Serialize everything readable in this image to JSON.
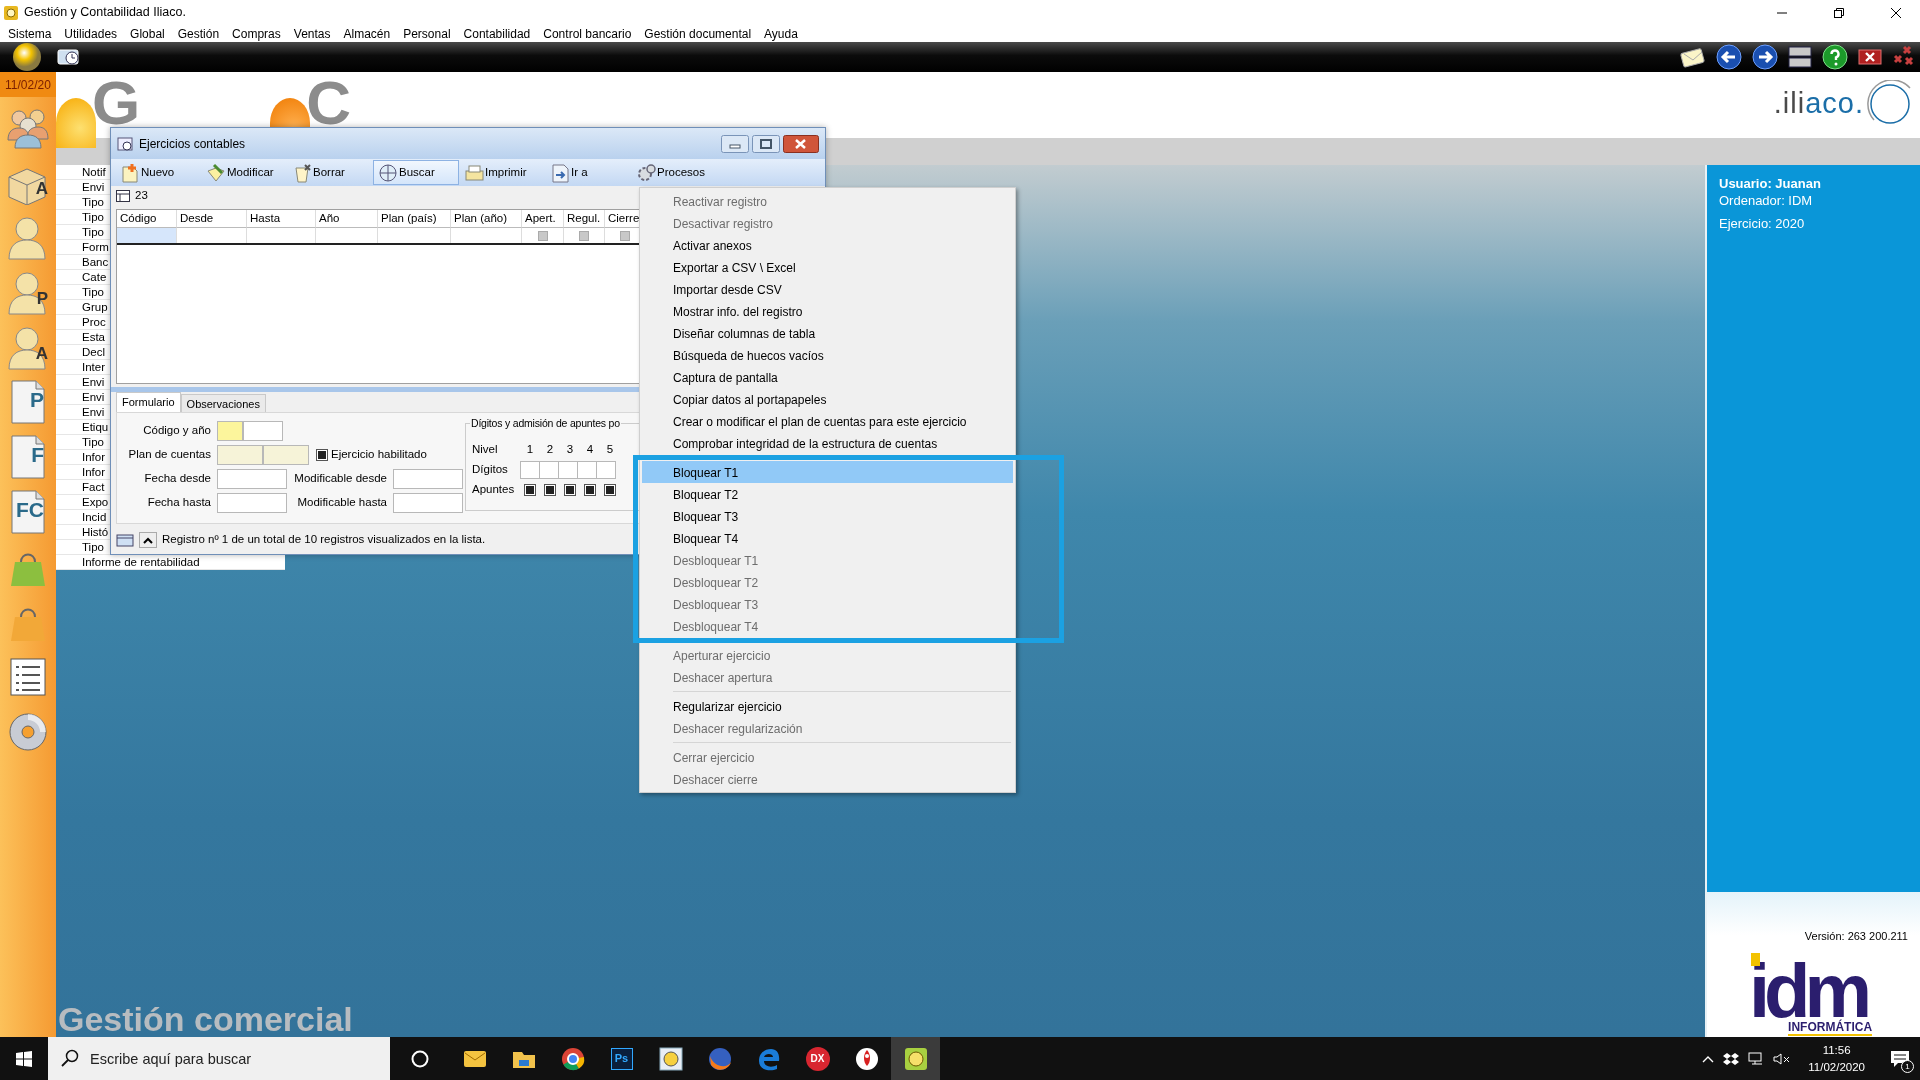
{
  "app_title": "Gestión y Contabilidad Iliaco.",
  "menu": [
    "Sistema",
    "Utilidades",
    "Global",
    "Gestión",
    "Compras",
    "Ventas",
    "Almacén",
    "Personal",
    "Contabilidad",
    "Control bancario",
    "Gestión documental",
    "Ayuda"
  ],
  "sidebar": {
    "date": "11/02/20",
    "buttons": [
      {
        "kind": "people"
      },
      {
        "kind": "box",
        "letter": "A"
      },
      {
        "kind": "person"
      },
      {
        "kind": "person",
        "letter": "P"
      },
      {
        "kind": "person",
        "letter": "A"
      },
      {
        "kind": "doc",
        "letter": "P"
      },
      {
        "kind": "doc",
        "letter": "F"
      },
      {
        "kind": "doc",
        "letter": "FC"
      },
      {
        "kind": "bag",
        "color": "#8cbf3f"
      },
      {
        "kind": "bag",
        "color": "#f2a838"
      },
      {
        "kind": "list"
      },
      {
        "kind": "disc"
      }
    ]
  },
  "logos": [
    {
      "letter": "G"
    },
    {
      "letter": "C"
    }
  ],
  "iliaco_logo": {
    "dark": ".ili",
    "blue": "aco."
  },
  "nav_list": [
    "Notif",
    "Envi",
    "Tipo",
    "Tipo",
    "Tipo",
    "Form",
    "Banc",
    "Cate",
    "Tipo",
    "Grup",
    "Proc",
    "Esta",
    "Decl",
    "Inter",
    "Envi",
    "Envi",
    "Envi",
    "Etiqu",
    "Tipo",
    "Infor",
    "Infor",
    "Fact",
    "Expo",
    "Incid",
    "Histó",
    "Tipo",
    "Informe de rentabilidad"
  ],
  "window": {
    "title": "Ejercicios contables",
    "toolbar": [
      {
        "kind": "new",
        "label": "Nuevo",
        "pressed": false
      },
      {
        "kind": "edit",
        "label": "Modificar",
        "pressed": false
      },
      {
        "kind": "delete",
        "label": "Borrar",
        "pressed": false
      },
      {
        "kind": "search",
        "label": "Buscar",
        "pressed": true
      },
      {
        "kind": "print",
        "label": "Imprimir",
        "pressed": false
      },
      {
        "kind": "goto",
        "label": "Ir a",
        "pressed": false
      },
      {
        "kind": "process",
        "label": "Procesos",
        "pressed": false
      }
    ],
    "record_count": "23",
    "table": {
      "columns": [
        {
          "label": "Código",
          "kind": "text"
        },
        {
          "label": "Desde",
          "kind": "text"
        },
        {
          "label": "Hasta",
          "kind": "text"
        },
        {
          "label": "Año",
          "kind": "text"
        },
        {
          "label": "Plan (país)",
          "kind": "text"
        },
        {
          "label": "Plan (año)",
          "kind": "text"
        },
        {
          "label": "Apert.",
          "kind": "flag"
        },
        {
          "label": "Regul.",
          "kind": "flag"
        },
        {
          "label": "Cierre",
          "kind": "flag"
        }
      ],
      "rows": [
        {
          "selected": true,
          "flags": [
            {
              "checked": false
            },
            {
              "checked": false
            },
            {
              "checked": false
            }
          ]
        }
      ]
    },
    "form_tabs": [
      {
        "label": "Formulario",
        "selected": true
      },
      {
        "label": "Observaciones",
        "selected": false
      }
    ],
    "form_rows": [
      [
        {
          "kind": "field",
          "label": "Código y año",
          "inputs": [
            {
              "kind": "required"
            },
            {
              "kind": "plain"
            }
          ]
        }
      ],
      [
        {
          "kind": "field",
          "label": "Plan de cuentas",
          "inputs": [
            {
              "kind": "readonly"
            },
            {
              "kind": "readonly"
            }
          ]
        },
        {
          "kind": "checkbox",
          "label": "Ejercicio habilitado",
          "checked": true
        }
      ],
      [
        {
          "kind": "field",
          "label": "Fecha desde",
          "inputs": [
            {
              "kind": "wide"
            }
          ]
        },
        {
          "kind": "field",
          "label": "Modificable desde",
          "inputs": [
            {
              "kind": "wide"
            }
          ]
        }
      ],
      [
        {
          "kind": "field",
          "label": "Fecha hasta",
          "inputs": [
            {
              "kind": "wide"
            }
          ]
        },
        {
          "kind": "field",
          "label": "Modificable hasta",
          "inputs": [
            {
              "kind": "wide"
            }
          ]
        }
      ]
    ],
    "digits_group": {
      "title": "Dígitos y admisión de apuntes po",
      "levels_label": "Nivel",
      "levels": [
        "1",
        "2",
        "3",
        "4",
        "5"
      ],
      "digits_label": "Dígitos",
      "entries_label": "Apuntes",
      "entries": [
        {
          "checked": true
        },
        {
          "checked": true
        },
        {
          "checked": true
        },
        {
          "checked": true
        },
        {
          "checked": true
        }
      ]
    },
    "status": "Registro nº 1 de un total de 10 registros visualizados en la lista."
  },
  "context_menu": {
    "items": [
      {
        "kind": "item",
        "label": "Reactivar registro",
        "disabled": true,
        "selected": false
      },
      {
        "kind": "item",
        "label": "Desactivar registro",
        "disabled": true,
        "selected": false
      },
      {
        "kind": "item",
        "label": "Activar anexos",
        "disabled": false,
        "selected": false
      },
      {
        "kind": "item",
        "label": "Exportar a CSV \\ Excel",
        "disabled": false,
        "selected": false
      },
      {
        "kind": "item",
        "label": "Importar desde CSV",
        "disabled": false,
        "selected": false
      },
      {
        "kind": "item",
        "label": "Mostrar info. del registro",
        "disabled": false,
        "selected": false
      },
      {
        "kind": "item",
        "label": "Diseñar columnas de tabla",
        "disabled": false,
        "selected": false
      },
      {
        "kind": "item",
        "label": "Búsqueda de huecos vacíos",
        "disabled": false,
        "selected": false
      },
      {
        "kind": "item",
        "label": "Captura de pantalla",
        "disabled": false,
        "selected": false
      },
      {
        "kind": "item",
        "label": "Copiar datos al portapapeles",
        "disabled": false,
        "selected": false
      },
      {
        "kind": "item",
        "label": "Crear o modificar el plan de cuentas para este ejercicio",
        "disabled": false,
        "selected": false
      },
      {
        "kind": "item",
        "label": "Comprobar integridad de la estructura de cuentas",
        "disabled": false,
        "selected": false
      },
      {
        "kind": "separator"
      },
      {
        "kind": "item",
        "label": "Bloquear T1",
        "disabled": false,
        "selected": true
      },
      {
        "kind": "item",
        "label": "Bloquear T2",
        "disabled": false,
        "selected": false
      },
      {
        "kind": "item",
        "label": "Bloquear T3",
        "disabled": false,
        "selected": false
      },
      {
        "kind": "item",
        "label": "Bloquear T4",
        "disabled": false,
        "selected": false
      },
      {
        "kind": "item",
        "label": "Desbloquear T1",
        "disabled": true,
        "selected": false
      },
      {
        "kind": "item",
        "label": "Desbloquear T2",
        "disabled": true,
        "selected": false
      },
      {
        "kind": "item",
        "label": "Desbloquear T3",
        "disabled": true,
        "selected": false
      },
      {
        "kind": "item",
        "label": "Desbloquear T4",
        "disabled": true,
        "selected": false
      },
      {
        "kind": "separator"
      },
      {
        "kind": "item",
        "label": "Aperturar ejercicio",
        "disabled": true,
        "selected": false
      },
      {
        "kind": "item",
        "label": "Deshacer apertura",
        "disabled": true,
        "selected": false
      },
      {
        "kind": "separator"
      },
      {
        "kind": "item",
        "label": "Regularizar ejercicio",
        "disabled": false,
        "selected": false
      },
      {
        "kind": "item",
        "label": "Deshacer regularización",
        "disabled": true,
        "selected": false
      },
      {
        "kind": "separator"
      },
      {
        "kind": "item",
        "label": "Cerrar ejercicio",
        "disabled": true,
        "selected": false
      },
      {
        "kind": "item",
        "label": "Deshacer cierre",
        "disabled": true,
        "selected": false
      }
    ]
  },
  "session": {
    "user": "Usuario: Juanan",
    "computer": "Ordenador: IDM",
    "year": "Ejercicio: 2020"
  },
  "version": "Versión: 263 200.211",
  "brand": {
    "name": "idm",
    "tagline": "INFORMÁTICA"
  },
  "module_caption": "Gestión comercial",
  "taskbar": {
    "search_placeholder": "Escribe aquí para buscar",
    "apps": [
      {
        "kind": "mail",
        "selected": false
      },
      {
        "kind": "folder",
        "selected": false
      },
      {
        "kind": "ring",
        "selected": false
      },
      {
        "kind": "tile",
        "label": "Ps",
        "selected": false
      },
      {
        "kind": "app",
        "selected": false
      },
      {
        "kind": "fox",
        "selected": false
      },
      {
        "kind": "edge",
        "selected": false
      },
      {
        "kind": "round",
        "label": "DX",
        "selected": false
      },
      {
        "kind": "rocket",
        "selected": false
      },
      {
        "kind": "appg",
        "selected": true
      }
    ],
    "time": "11:56",
    "date": "11/02/2020",
    "notifications": "1"
  }
}
